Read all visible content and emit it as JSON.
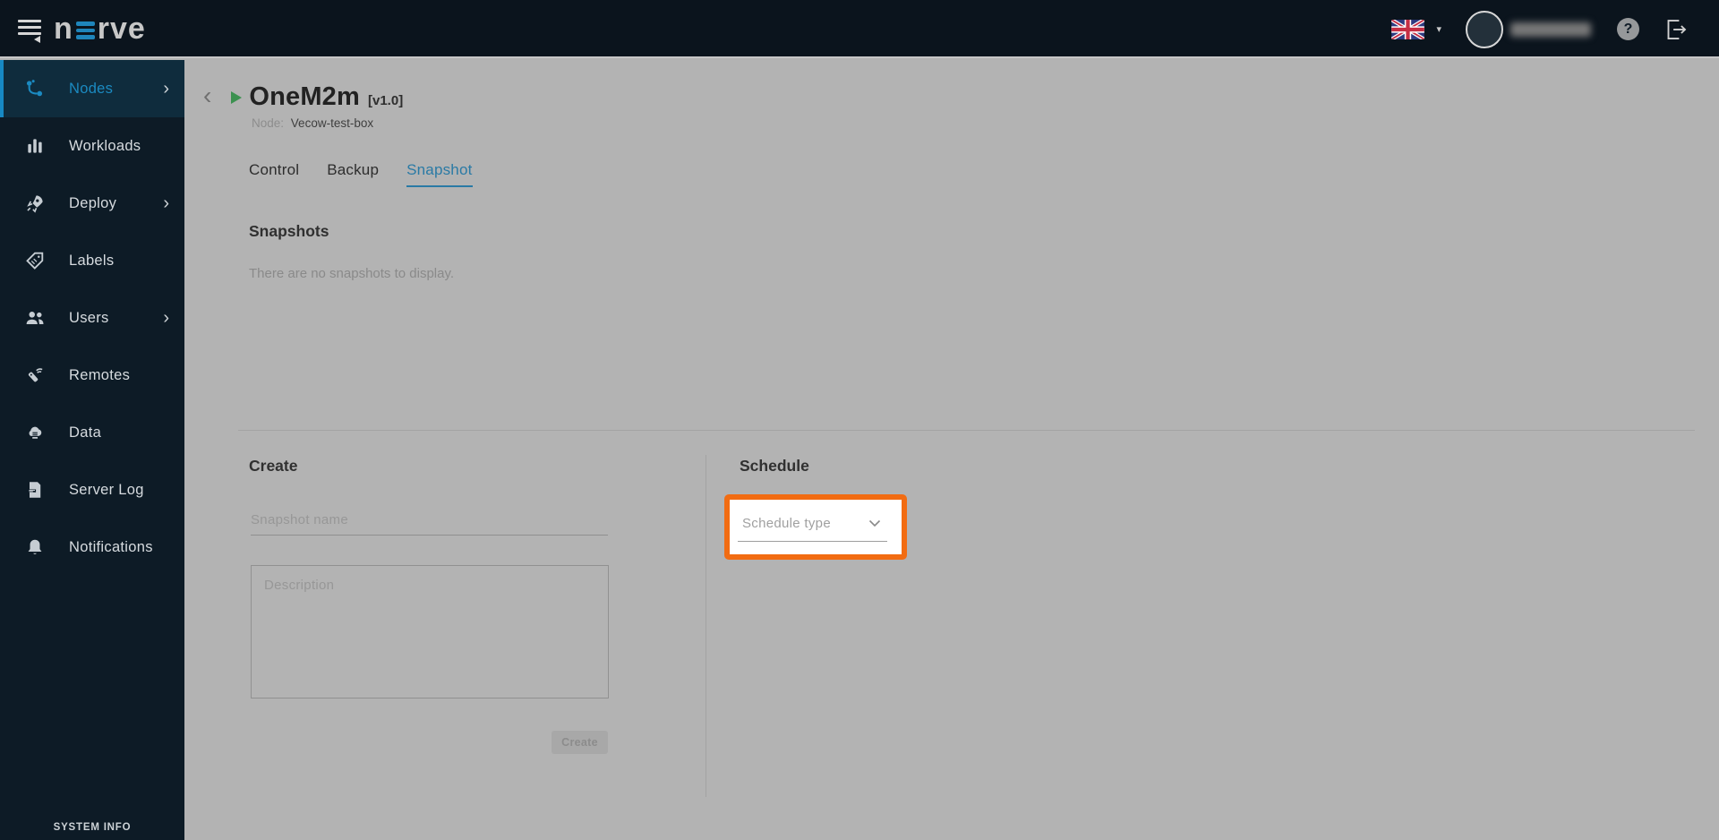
{
  "topbar": {
    "logo_prefix": "n",
    "logo_suffix": "rve",
    "help_glyph": "?"
  },
  "icons": {
    "chevron_right": "›",
    "caret_down": "▾",
    "back_chevron": "‹"
  },
  "sidebar": {
    "items": [
      {
        "label": "Nodes",
        "icon": "nodes-icon",
        "expandable": true,
        "active": true
      },
      {
        "label": "Workloads",
        "icon": "workloads-icon",
        "expandable": false,
        "active": false
      },
      {
        "label": "Deploy",
        "icon": "deploy-icon",
        "expandable": true,
        "active": false
      },
      {
        "label": "Labels",
        "icon": "labels-icon",
        "expandable": false,
        "active": false
      },
      {
        "label": "Users",
        "icon": "users-icon",
        "expandable": true,
        "active": false
      },
      {
        "label": "Remotes",
        "icon": "remotes-icon",
        "expandable": false,
        "active": false
      },
      {
        "label": "Data",
        "icon": "data-icon",
        "expandable": false,
        "active": false
      },
      {
        "label": "Server Log",
        "icon": "server-log-icon",
        "expandable": false,
        "active": false
      },
      {
        "label": "Notifications",
        "icon": "notifications-icon",
        "expandable": false,
        "active": false
      }
    ],
    "system_info": "SYSTEM INFO"
  },
  "content": {
    "header": {
      "title": "OneM2m",
      "version": "[v1.0]",
      "node_label": "Node:",
      "node_name": "Vecow-test-box"
    },
    "tabs": [
      {
        "label": "Control"
      },
      {
        "label": "Backup"
      },
      {
        "label": "Snapshot"
      }
    ],
    "active_tab": "Snapshot",
    "snapshots": {
      "heading": "Snapshots",
      "empty_message": "There are no snapshots to display."
    },
    "create": {
      "heading": "Create",
      "name_placeholder": "Snapshot name",
      "description_placeholder": "Description",
      "button_label": "Create"
    },
    "schedule": {
      "heading": "Schedule",
      "type_placeholder": "Schedule type"
    }
  },
  "colors": {
    "accent_blue": "#1b8ac1",
    "tab_blue": "#2a7aa5",
    "highlight_orange": "#f26c12",
    "play_green": "#3c9150",
    "main_bg": "#b3b3b3",
    "topbar_bg": "#0b141d",
    "sidebar_bg": "#0d1b26"
  }
}
